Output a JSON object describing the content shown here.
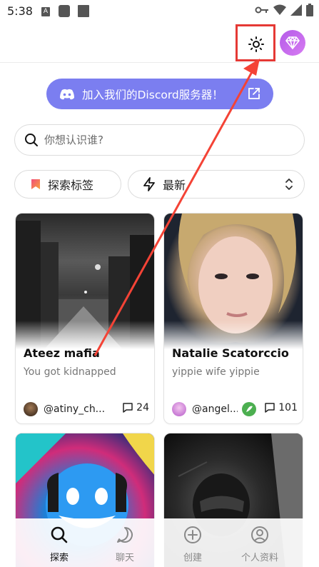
{
  "status_bar": {
    "time": "5:38",
    "icons": [
      "a-icon",
      "square-icon",
      "square-icon",
      "key-icon",
      "wifi-icon",
      "signal-icon",
      "battery-icon"
    ]
  },
  "header": {
    "theme_toggle_icon": "sun-icon",
    "premium_icon": "gem-icon",
    "highlight_color": "#e53935"
  },
  "discord_banner": {
    "label": "加入我们的Discord服务器！",
    "icon": "discord-icon",
    "external_icon": "external-link-icon",
    "color": "#7b7ef0"
  },
  "search": {
    "placeholder": "你想认识谁?",
    "value": ""
  },
  "filters": {
    "tags_label": "探索标签",
    "sort_label": "最新"
  },
  "cards": [
    {
      "name": "Ateez mafia",
      "description": "You got kidnapped",
      "author": "@atiny_ch...",
      "chats": "24"
    },
    {
      "name": "Natalie Scatorccio",
      "description": "yippie wife yippie",
      "author": "@angel...",
      "chats": "101"
    },
    {
      "name": "",
      "description": "",
      "author": "",
      "chats": ""
    },
    {
      "name": "",
      "description": "",
      "author": "",
      "chats": ""
    }
  ],
  "bottom_nav": [
    {
      "label": "探索",
      "icon": "search-icon",
      "active": true
    },
    {
      "label": "聊天",
      "icon": "chat-bubble-icon",
      "active": false
    },
    {
      "label": "创建",
      "icon": "plus-circle-icon",
      "active": false
    },
    {
      "label": "个人资料",
      "icon": "user-circle-icon",
      "active": false
    }
  ],
  "annotation": {
    "arrow_color": "#f44336"
  }
}
